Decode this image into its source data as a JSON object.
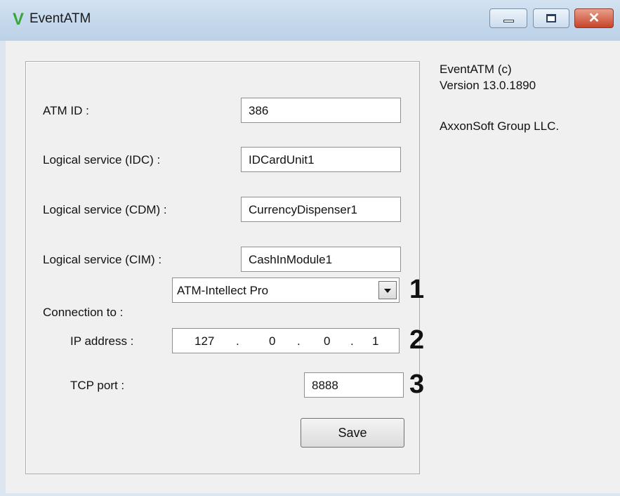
{
  "window": {
    "title": "EventATM",
    "app_icon_glyph": "V",
    "controls": {
      "minimize": "minimize-icon",
      "maximize": "maximize-icon",
      "close": "close-icon",
      "close_glyph": "✕"
    }
  },
  "form": {
    "atm_id": {
      "label": "ATM ID :",
      "value": "386"
    },
    "idc": {
      "label": "Logical service (IDC) :",
      "value": "IDCardUnit1"
    },
    "cdm": {
      "label": "Logical service (CDM) :",
      "value": "CurrencyDispenser1"
    },
    "cim": {
      "label": "Logical service (CIM) :",
      "value": "CashInModule1"
    },
    "connection": {
      "label": "Connection to :",
      "selected": "ATM-Intellect Pro",
      "marker": "1"
    },
    "ip": {
      "label": "IP address :",
      "octets": [
        "127",
        "0",
        "0",
        "1"
      ],
      "separator": ".",
      "marker": "2"
    },
    "tcp_port": {
      "label": "TCP port :",
      "value": "8888",
      "marker": "3"
    },
    "save_label": "Save"
  },
  "about": {
    "product": "EventATM (c)",
    "version": "Version 13.0.1890",
    "company": "AxxonSoft Group LLC."
  }
}
